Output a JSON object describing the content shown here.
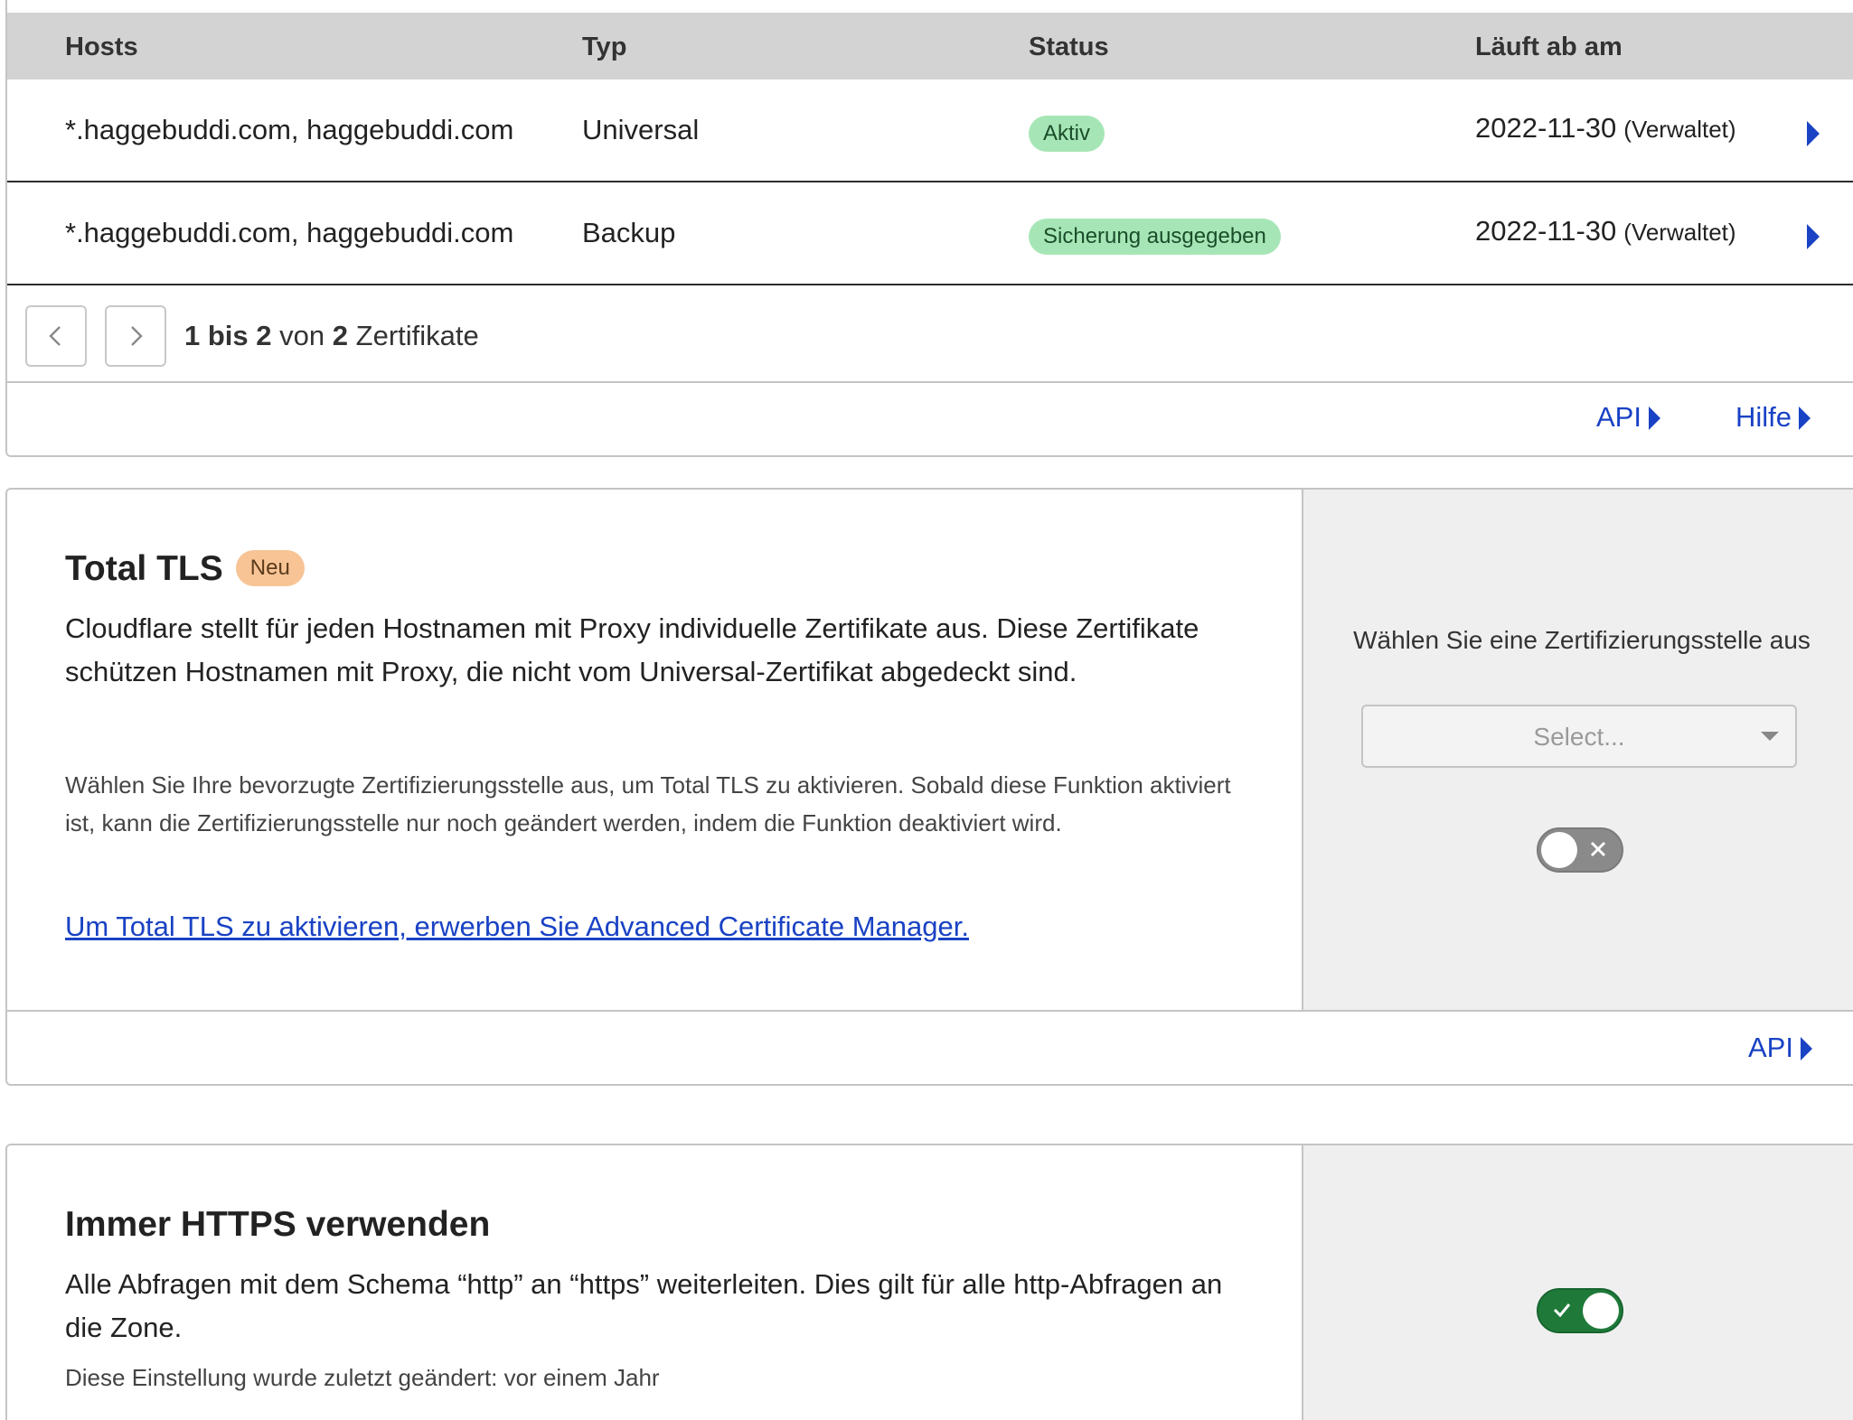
{
  "certificates": {
    "columns": {
      "hosts": "Hosts",
      "type": "Typ",
      "status": "Status",
      "expires": "Läuft ab am"
    },
    "rows": [
      {
        "hosts": "*.haggebuddi.com, haggebuddi.com",
        "type": "Universal",
        "status": "Aktiv",
        "expires": "2022-11-30",
        "managed": "(Verwaltet)"
      },
      {
        "hosts": "*.haggebuddi.com, haggebuddi.com",
        "type": "Backup",
        "status": "Sicherung ausgegeben",
        "expires": "2022-11-30",
        "managed": "(Verwaltet)"
      }
    ],
    "pagination": {
      "from": "1",
      "to_word": "bis",
      "to": "2",
      "of_word": "von",
      "total": "2",
      "unit": "Zertifikate"
    },
    "footer": {
      "api": "API",
      "help": "Hilfe"
    }
  },
  "total_tls": {
    "title": "Total TLS",
    "badge": "Neu",
    "description": "Cloudflare stellt für jeden Hostnamen mit Proxy individuelle Zertifikate aus. Diese Zertifikate schützen Hostnamen mit Proxy, die nicht vom Universal-Zertifikat abgedeckt sind.",
    "note": "Wählen Sie Ihre bevorzugte Zertifizierungsstelle aus, um Total TLS zu aktivieren. Sobald diese Funktion aktiviert ist, kann die Zertifizierungsstelle nur noch geändert werden, indem die Funktion deaktiviert wird.",
    "link": "Um Total TLS zu aktivieren, erwerben Sie Advanced Certificate Manager.",
    "ca_label": "Wählen Sie eine Zertifizierungsstelle aus",
    "select_placeholder": "Select...",
    "toggle_state": "off",
    "footer_api": "API"
  },
  "always_https": {
    "title": "Immer HTTPS verwenden",
    "description": "Alle Abfragen mit dem Schema “http” an “https” weiterleiten. Dies gilt für alle http-Abfragen an die Zone.",
    "note": "Diese Einstellung wurde zuletzt geändert: vor einem Jahr",
    "toggle_state": "on"
  },
  "colors": {
    "link": "#1942c4",
    "active_badge": "#a6e6b6",
    "new_badge": "#f8c496",
    "toggle_on": "#1f7a3a",
    "toggle_off": "#8a8a8a"
  },
  "icons": {
    "pager_prev": "chevron-left-icon",
    "pager_next": "chevron-right-icon",
    "row_detail": "caret-right-icon",
    "toggle_off": "x-icon",
    "toggle_on": "check-icon"
  }
}
